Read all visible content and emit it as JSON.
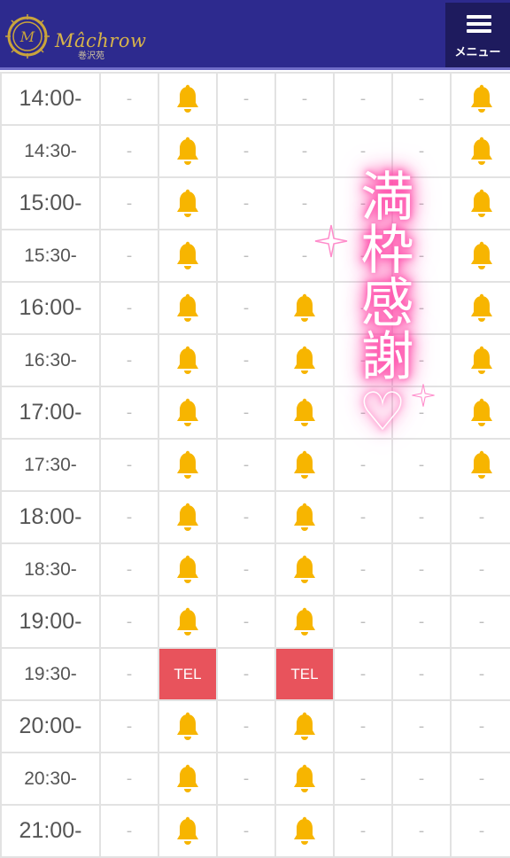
{
  "header": {
    "logo_text": "Mâchrow",
    "logo_subtext": "巻沢苑",
    "menu_label": "メニュー",
    "background_color": "#2d2a8e"
  },
  "schedule": {
    "rows": [
      {
        "time": "14:00-",
        "cells": [
          "-",
          "bell",
          "-",
          "-",
          "-",
          "-",
          "bell"
        ]
      },
      {
        "time": "14:30-",
        "cells": [
          "-",
          "bell",
          "-",
          "-",
          "-",
          "-",
          "bell"
        ]
      },
      {
        "time": "15:00-",
        "cells": [
          "-",
          "bell",
          "-",
          "-",
          "-",
          "-",
          "bell"
        ]
      },
      {
        "time": "15:30-",
        "cells": [
          "-",
          "bell",
          "-",
          "-",
          "-",
          "-",
          "bell"
        ]
      },
      {
        "time": "16:00-",
        "cells": [
          "-",
          "bell",
          "-",
          "bell",
          "-",
          "-",
          "bell"
        ]
      },
      {
        "time": "16:30-",
        "cells": [
          "-",
          "bell",
          "-",
          "bell",
          "-",
          "-",
          "bell"
        ]
      },
      {
        "time": "17:00-",
        "cells": [
          "-",
          "bell",
          "-",
          "bell",
          "-",
          "-",
          "bell"
        ]
      },
      {
        "time": "17:30-",
        "cells": [
          "-",
          "bell",
          "-",
          "bell",
          "-",
          "-",
          "bell"
        ]
      },
      {
        "time": "18:00-",
        "cells": [
          "-",
          "bell",
          "-",
          "bell",
          "-",
          "-",
          "-"
        ]
      },
      {
        "time": "18:30-",
        "cells": [
          "-",
          "bell",
          "-",
          "bell",
          "-",
          "-",
          "-"
        ]
      },
      {
        "time": "19:00-",
        "cells": [
          "-",
          "bell",
          "-",
          "bell",
          "-",
          "-",
          "-"
        ]
      },
      {
        "time": "19:30-",
        "cells": [
          "-",
          "TEL",
          "-",
          "TEL",
          "-",
          "-",
          "-"
        ]
      },
      {
        "time": "20:00-",
        "cells": [
          "-",
          "bell",
          "-",
          "bell",
          "-",
          "-",
          "-"
        ]
      },
      {
        "time": "20:30-",
        "cells": [
          "-",
          "bell",
          "-",
          "bell",
          "-",
          "-",
          "-"
        ]
      },
      {
        "time": "21:00-",
        "cells": [
          "-",
          "bell",
          "-",
          "bell",
          "-",
          "-",
          "-"
        ]
      }
    ],
    "bell_color": "#f7b500",
    "tel_color": "#e8535c"
  },
  "overlay": {
    "text": "満枠感謝♡",
    "glow_color": "#ff3ca0"
  }
}
